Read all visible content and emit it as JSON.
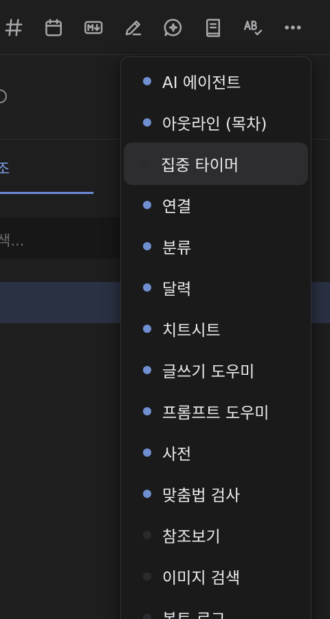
{
  "toolbar": {
    "icons": [
      "hashtag-icon",
      "calendar-icon",
      "markdown-icon",
      "pen-icon",
      "chat-assistant-icon",
      "notebook-icon",
      "spellcheck-icon",
      "more-icon"
    ]
  },
  "background": {
    "tab_label": "조",
    "search_placeholder": "색..."
  },
  "menu": {
    "items": [
      {
        "label": "AI 에이전트",
        "enabled": true
      },
      {
        "label": "아웃라인 (목차)",
        "enabled": true
      },
      {
        "label": "집중 타이머",
        "enabled": false,
        "highlighted": true
      },
      {
        "label": "연결",
        "enabled": true
      },
      {
        "label": "분류",
        "enabled": true
      },
      {
        "label": "달력",
        "enabled": true
      },
      {
        "label": "치트시트",
        "enabled": true
      },
      {
        "label": "글쓰기 도우미",
        "enabled": true
      },
      {
        "label": "프롬프트 도우미",
        "enabled": true
      },
      {
        "label": "사전",
        "enabled": true
      },
      {
        "label": "맞춤법 검사",
        "enabled": true
      },
      {
        "label": "참조보기",
        "enabled": false
      },
      {
        "label": "이미지 검색",
        "enabled": false
      },
      {
        "label": "봇트 로그",
        "enabled": false
      }
    ]
  },
  "colors": {
    "accent": "#6f8fd1",
    "background": "#1e1e1f",
    "menu_background": "#1a1a1b"
  }
}
